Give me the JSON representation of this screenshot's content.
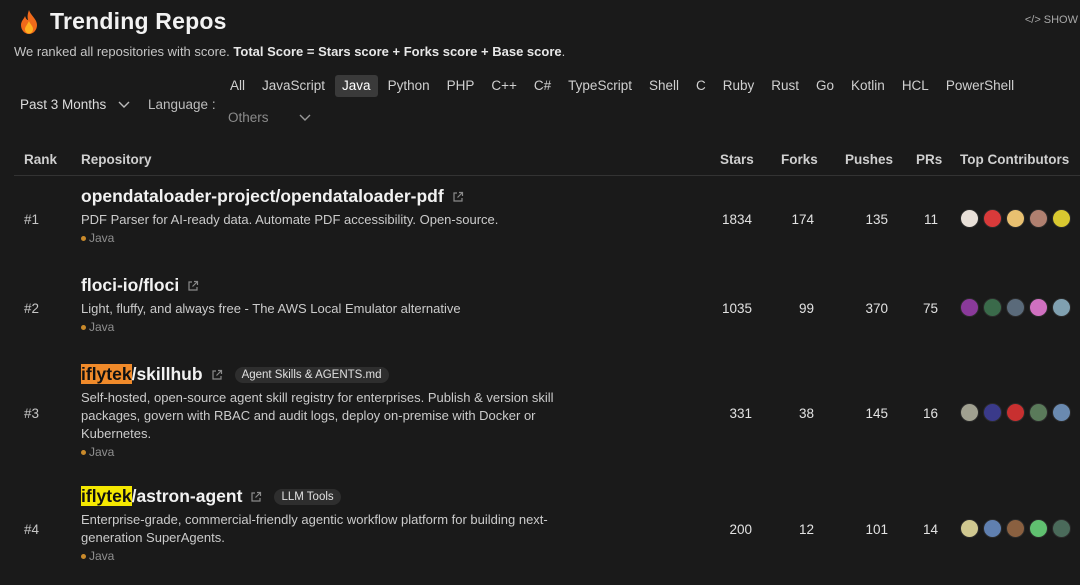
{
  "header": {
    "title": "Trending Repos",
    "show_label": "SHOW"
  },
  "subtitle": {
    "prefix": "We ranked all repositories with score.",
    "formula": "Total Score = Stars score + Forks score + Base score",
    "suffix": "."
  },
  "filters": {
    "period": "Past 3 Months",
    "language_label": "Language :",
    "languages": [
      "All",
      "JavaScript",
      "Java",
      "Python",
      "PHP",
      "C++",
      "C#",
      "TypeScript",
      "Shell",
      "C",
      "Ruby",
      "Rust",
      "Go",
      "Kotlin",
      "HCL",
      "PowerShell"
    ],
    "active_language": "Java",
    "others": "Others"
  },
  "table": {
    "headers": {
      "rank": "Rank",
      "repository": "Repository",
      "stars": "Stars",
      "forks": "Forks",
      "pushes": "Pushes",
      "prs": "PRs",
      "contributors": "Top Contributors"
    },
    "rows": [
      {
        "rank": "#1",
        "owner": "opendataloader-project",
        "name": "/opendataloader-pdf",
        "highlight": "",
        "tag": "",
        "description": "PDF Parser for AI-ready data. Automate PDF accessibility. Open-source.",
        "language": "Java",
        "stars": "1834",
        "forks": "174",
        "pushes": "135",
        "prs": "11",
        "avatars": [
          "#e8e0d8",
          "#d83a3a",
          "#e8c070",
          "#b08070",
          "#d8c830"
        ]
      },
      {
        "rank": "#2",
        "owner": "floci-io",
        "name": "/floci",
        "highlight": "",
        "tag": "",
        "description": "Light, fluffy, and always free - The AWS Local Emulator alternative",
        "language": "Java",
        "stars": "1035",
        "forks": "99",
        "pushes": "370",
        "prs": "75",
        "avatars": [
          "#8a3a9a",
          "#3a6a4a",
          "#5a6a7a",
          "#d070c0",
          "#80a0b0"
        ]
      },
      {
        "rank": "#3",
        "owner": "iflytek",
        "name": "/skillhub",
        "highlight": "orange",
        "tag": "Agent Skills & AGENTS.md",
        "description": "Self-hosted, open-source agent skill registry for enterprises. Publish & version skill packages, govern with RBAC and audit logs, deploy on-premise with Docker or Kubernetes.",
        "language": "Java",
        "stars": "331",
        "forks": "38",
        "pushes": "145",
        "prs": "16",
        "avatars": [
          "#a0a090",
          "#3a3a8a",
          "#c83030",
          "#5a7a5a",
          "#6a8ab0"
        ]
      },
      {
        "rank": "#4",
        "owner": "iflytek",
        "name": "/astron-agent",
        "highlight": "yellow",
        "tag": "LLM Tools",
        "description": "Enterprise-grade, commercial-friendly agentic workflow platform for building next-generation SuperAgents.",
        "language": "Java",
        "stars": "200",
        "forks": "12",
        "pushes": "101",
        "prs": "14",
        "avatars": [
          "#d0c890",
          "#6080b0",
          "#8a6040",
          "#60c070",
          "#4a6a5a"
        ]
      }
    ]
  }
}
